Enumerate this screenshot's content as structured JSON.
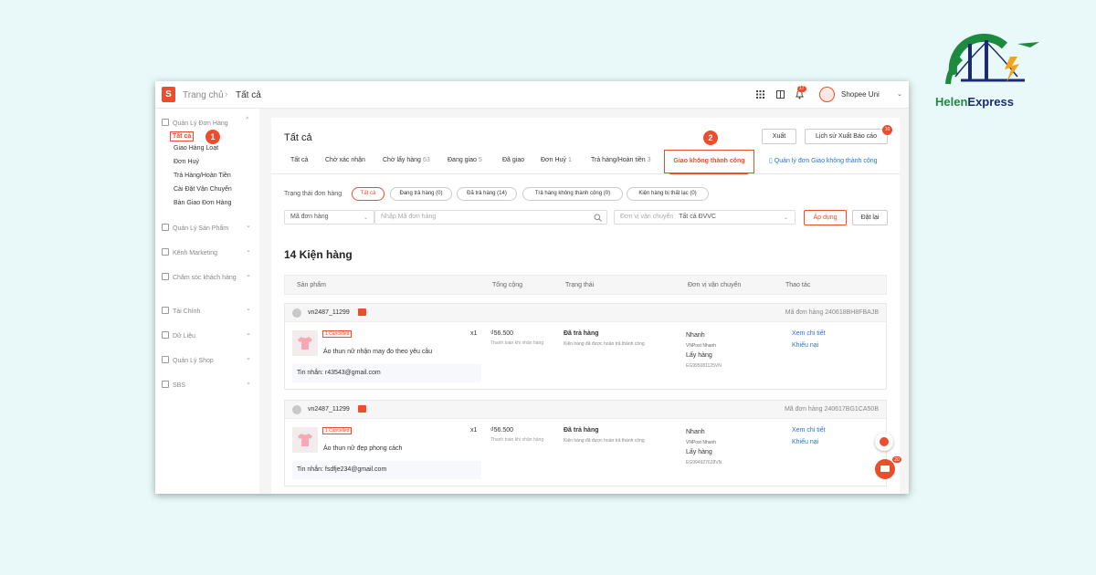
{
  "brand": {
    "logo_part1": "Helen",
    "logo_part2": "Express"
  },
  "topbar": {
    "breadcrumb_home": "Trang chủ",
    "breadcrumb_current": "Tất cả",
    "notification_count": "17",
    "shop_name": "Shopee Uni"
  },
  "sidebar": {
    "groups": [
      {
        "label": "Quản Lý Đơn Hàng",
        "icon": "clipboard-icon"
      },
      {
        "label": "Quản Lý Sản Phẩm",
        "icon": "box-icon"
      },
      {
        "label": "Kênh Marketing",
        "icon": "tag-icon"
      },
      {
        "label": "Chăm sóc khách hàng",
        "icon": "headset-icon"
      },
      {
        "label": "Tài Chính",
        "icon": "wallet-icon"
      },
      {
        "label": "Dữ Liệu",
        "icon": "chart-icon"
      },
      {
        "label": "Quản Lý Shop",
        "icon": "shop-icon"
      },
      {
        "label": "SBS",
        "icon": "warehouse-icon"
      }
    ],
    "items": [
      "Tất cả",
      "Giao Hàng Loạt",
      "Đơn Huỷ",
      "Trả Hàng/Hoàn Tiền",
      "Cài Đặt Vận Chuyển",
      "Bàn Giao Đơn Hàng"
    ],
    "step1": "1"
  },
  "main": {
    "title": "Tất cả",
    "export_label": "Xuất",
    "export_history_label": "Lịch sử Xuất Báo cáo",
    "export_history_badge": "10",
    "step2": "2",
    "tabs": [
      {
        "label": "Tất cả",
        "count": ""
      },
      {
        "label": "Chờ xác nhận",
        "count": ""
      },
      {
        "label": "Chờ lấy hàng",
        "count": "63"
      },
      {
        "label": "Đang giao",
        "count": "5"
      },
      {
        "label": "Đã giao",
        "count": ""
      },
      {
        "label": "Đơn Huỷ",
        "count": "1"
      },
      {
        "label": "Trả hàng/Hoàn tiền",
        "count": "3"
      }
    ],
    "active_tab": "Giao không thành công",
    "tab_link": "Quản lý đơn Giao không thành công",
    "status_label": "Trạng thái đơn hàng",
    "status_pills": [
      "Tất cả",
      "Đang trả hàng (0)",
      "Đã trả hàng (14)",
      "Trả hàng không thành công (0)",
      "Kiện hàng bị thất lạc (0)"
    ],
    "search_type": "Mã đơn hàng",
    "search_placeholder": "Nhập Mã đơn hàng",
    "carrier_label": "Đơn vị vận chuyển",
    "carrier_value": "Tất cả ĐVVC",
    "apply_label": "Áp dụng",
    "reset_label": "Đặt lại",
    "count_title": "14 Kiện hàng",
    "columns": [
      "Sản phẩm",
      "Tổng cộng",
      "Trạng thái",
      "Đơn vị vận chuyển",
      "Thao tác"
    ],
    "chat_badge": "20"
  },
  "orders": [
    {
      "buyer": "vn2487_11299",
      "order_id": "Mã đơn hàng 240618BH8FBAJB",
      "tag": "1 Cancelled",
      "product": "Áo thun nữ nhận may đo theo yêu cầu",
      "qty": "x1",
      "message": "Tin nhắn: r43543@gmail.com",
      "price": "₫56.500",
      "payment": "Thanh toán khi nhận hàng",
      "status": "Đã trả hàng",
      "status_sub": "Kiện hàng đã được hoàn trả thành công",
      "ship_speed": "Nhanh",
      "ship_carrier": "VNPost Nhanh",
      "ship_method": "Lấy hàng",
      "tracking": "EG995081125VN",
      "action1": "Xem chi tiết",
      "action2": "Khiếu nại"
    },
    {
      "buyer": "vn2487_11299",
      "order_id": "Mã đơn hàng 240617BG1CA50B",
      "tag": "1 Cancelled",
      "product": "Áo thun nữ đẹp phong cách",
      "qty": "x1",
      "message": "Tin nhắn: fsdfje234@gmail.com",
      "price": "₫56.500",
      "payment": "Thanh toán khi nhận hàng",
      "status": "Đã trả hàng",
      "status_sub": "Kiện hàng đã được hoàn trả thành công",
      "ship_speed": "Nhanh",
      "ship_carrier": "VNPost Nhanh",
      "ship_method": "Lấy hàng",
      "tracking": "EG994927628VN",
      "action1": "Xem chi tiết",
      "action2": "Khiếu nại"
    }
  ],
  "colors": {
    "accent": "#ee4d2d",
    "link": "#2673dd",
    "background": "#e9f9f9"
  }
}
